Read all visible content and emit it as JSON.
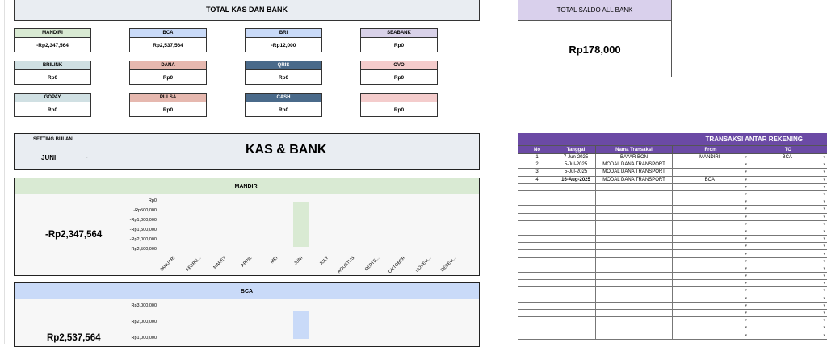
{
  "header": {
    "title": "TOTAL KAS DAN BANK"
  },
  "accounts": [
    {
      "name": "MANDIRI",
      "value": "-Rp2,347,564",
      "color": "#d9ead3"
    },
    {
      "name": "BCA",
      "value": "Rp2,537,564",
      "color": "#c9daf8"
    },
    {
      "name": "BRI",
      "value": "-Rp12,000",
      "color": "#c9daf8"
    },
    {
      "name": "SEABANK",
      "value": "Rp0",
      "color": "#d9d2e9"
    },
    {
      "name": "BRILINK",
      "value": "Rp0",
      "color": "#d0e0e3"
    },
    {
      "name": "DANA",
      "value": "Rp0",
      "color": "#e6b8af"
    },
    {
      "name": "QRIS",
      "value": "Rp0",
      "color": "#4a6a8a"
    },
    {
      "name": "OVO",
      "value": "Rp0",
      "color": "#f4cccc"
    },
    {
      "name": "GOPAY",
      "value": "Rp0",
      "color": "#d0e0e3"
    },
    {
      "name": "PULSA",
      "value": "Rp0",
      "color": "#e6b8af"
    },
    {
      "name": "CASH",
      "value": "Rp0",
      "color": "#4a6a8a"
    },
    {
      "name": "",
      "value": "Rp0",
      "color": "#f4cccc"
    }
  ],
  "saldo": {
    "label": "TOTAL SALDO ALL BANK",
    "value": "Rp178,000"
  },
  "setting": {
    "label": "SETTING BULAN",
    "month": "JUNI",
    "dash": "-",
    "title": "KAS & BANK"
  },
  "mandiri_panel": {
    "title": "MANDIRI",
    "amount": "-Rp2,347,564"
  },
  "bca_panel": {
    "title": "BCA",
    "amount": "Rp2,537,564"
  },
  "months": [
    "JANUARI",
    "FEBRU...",
    "MARET",
    "APRIL",
    "MEI",
    "JUNI",
    "JULY",
    "AGUSTUS",
    "SEPTE...",
    "OKTOBER",
    "NOVEM...",
    "DESEM..."
  ],
  "chart_data": [
    {
      "type": "bar",
      "title": "MANDIRI",
      "categories": [
        "JANUARI",
        "FEBRU...",
        "MARET",
        "APRIL",
        "MEI",
        "JUNI",
        "JULY",
        "AGUSTUS",
        "SEPTE...",
        "OKTOBER",
        "NOVEM...",
        "DESEM..."
      ],
      "values": [
        0,
        0,
        0,
        0,
        0,
        -2347564,
        0,
        0,
        0,
        0,
        0,
        0
      ],
      "ytick_labels": [
        "Rp0",
        "-Rp500,000",
        "-Rp1,000,000",
        "-Rp1,500,000",
        "-Rp2,000,000",
        "-Rp2,500,000"
      ],
      "ylim": [
        -2500000,
        0
      ],
      "bar_color": "#d9ead3"
    },
    {
      "type": "bar",
      "title": "BCA",
      "categories": [
        "JANUARI",
        "FEBRU...",
        "MARET",
        "APRIL",
        "MEI",
        "JUNI",
        "JULY",
        "AGUSTUS",
        "SEPTE...",
        "OKTOBER",
        "NOVEM...",
        "DESEM..."
      ],
      "values": [
        0,
        0,
        0,
        0,
        0,
        2537564,
        0,
        0,
        0,
        0,
        0,
        0
      ],
      "ytick_labels": [
        "Rp3,000,000",
        "Rp2,000,000",
        "Rp1,000,000"
      ],
      "ylim": [
        0,
        3000000
      ],
      "bar_color": "#c9daf8"
    }
  ],
  "transfers": {
    "title": "TRANSAKSI ANTAR REKENING",
    "columns": [
      "No",
      "Tanggal",
      "Nama Transaksi",
      "From",
      "TO"
    ],
    "rows": [
      [
        "1",
        "7-Jun-2025",
        "BAYAR BON",
        "MANDIRI",
        "BCA"
      ],
      [
        "2",
        "5-Jul-2025",
        "MODAL DANA TRANSPORT",
        "",
        ""
      ],
      [
        "3",
        "5-Jul-2025",
        "MODAL DANA TRANSPORT",
        "",
        ""
      ],
      [
        "4",
        "16-Aug-2025",
        "MODAL DANA TRANSPORT",
        "BCA",
        ""
      ]
    ],
    "empty_rows": 21
  }
}
